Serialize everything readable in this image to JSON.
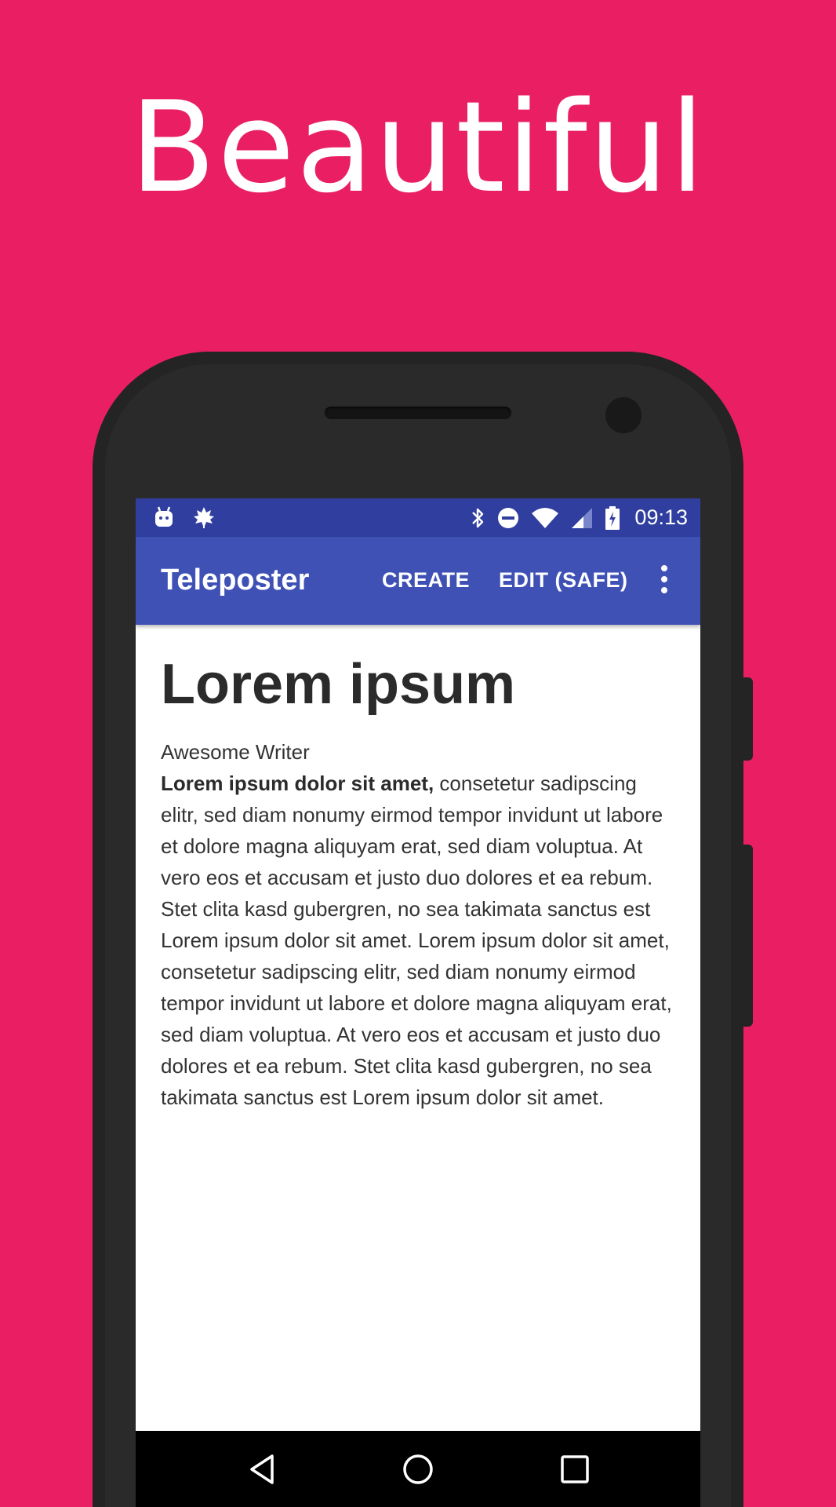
{
  "promo": {
    "headline": "Beautiful",
    "background_color": "#EA1F63"
  },
  "status_bar": {
    "time": "09:13",
    "color": "#303F9F",
    "left_icons": [
      "android-notification-icon",
      "leaf-notification-icon"
    ],
    "right_icons": [
      "bluetooth-icon",
      "do-not-disturb-icon",
      "wifi-icon",
      "cell-signal-icon",
      "battery-charging-icon"
    ]
  },
  "app_bar": {
    "title": "Teleposter",
    "color": "#3F51B5",
    "actions": {
      "create": "CREATE",
      "edit": "EDIT (SAFE)"
    },
    "overflow_icon": "more-vert-icon"
  },
  "document": {
    "title": "Lorem ipsum",
    "author": "Awesome Writer",
    "lead_bold": "Lorem ipsum dolor sit amet,",
    "body": " consetetur sadipscing elitr, sed diam nonumy eirmod tempor invidunt ut labore et dolore magna aliquyam erat, sed diam voluptua. At vero eos et accusam et justo duo dolores et ea rebum. Stet clita kasd gubergren, no sea takimata sanctus est Lorem ipsum dolor sit amet. Lorem ipsum dolor sit amet, consetetur sadipscing elitr, sed diam nonumy eirmod tempor invidunt ut labore et dolore magna aliquyam erat, sed diam voluptua. At vero eos et accusam et justo duo dolores et ea rebum. Stet clita kasd gubergren, no sea takimata sanctus est Lorem ipsum dolor sit amet."
  },
  "nav_bar": {
    "icons": [
      "back-icon",
      "home-icon",
      "recents-icon"
    ]
  }
}
